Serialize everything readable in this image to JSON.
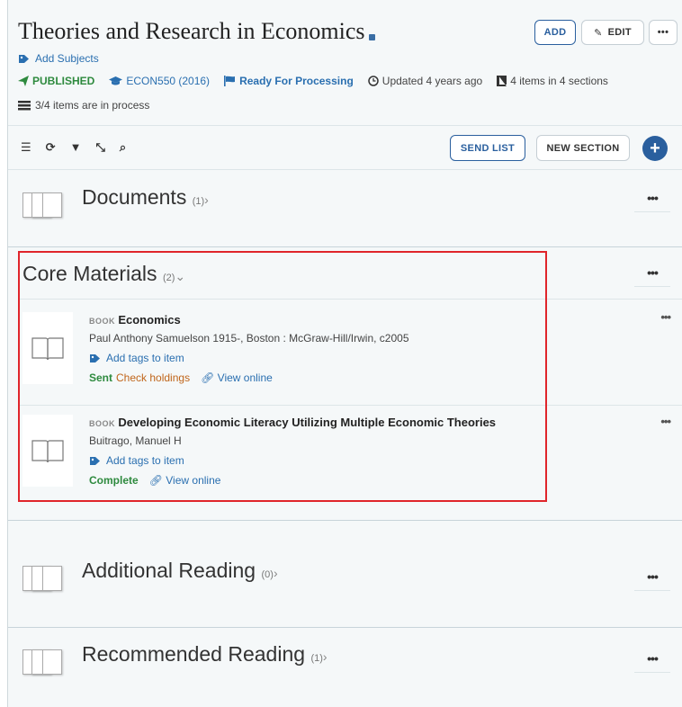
{
  "header": {
    "title": "Theories and Research in Economics",
    "add_label": "ADD",
    "edit_label": "EDIT",
    "more_label": "•••",
    "add_subjects": "Add Subjects",
    "status_published": "PUBLISHED",
    "course": "ECON550 (2016)",
    "processing": "Ready For Processing",
    "updated": "Updated 4 years ago",
    "items_count": "4 items in 4 sections",
    "in_process": "3/4 items are in process"
  },
  "toolbar": {
    "send_list": "SEND LIST",
    "new_section": "NEW SECTION",
    "plus": "+"
  },
  "sections": [
    {
      "title": "Documents",
      "count": "(1)",
      "more": "•••"
    },
    {
      "title": "Core Materials",
      "count": "(2)",
      "more": "•••"
    },
    {
      "title": "Additional Reading",
      "count": "(0)",
      "more": "•••"
    },
    {
      "title": "Recommended Reading",
      "count": "(1)",
      "more": "•••"
    }
  ],
  "items": [
    {
      "type": "BOOK",
      "title": "Economics",
      "author": "Paul Anthony Samuelson 1915-, Boston : McGraw-Hill/Irwin, c2005",
      "tags": "Add tags to item",
      "status": "Sent",
      "check": "Check holdings",
      "view": "View online",
      "more": "•••"
    },
    {
      "type": "BOOK",
      "title": "Developing Economic Literacy Utilizing Multiple Economic Theories",
      "author": "Buitrago, Manuel H",
      "tags": "Add tags to item",
      "status": "Complete",
      "view": "View online",
      "more": "•••"
    }
  ],
  "colors": {
    "accent": "#2a5f9e",
    "link": "#2a6fb0",
    "success": "#2e8a3e",
    "warning": "#c0651a",
    "highlight": "#e0252b"
  },
  "icons": [
    "tag-icon",
    "paper-plane-icon",
    "graduation-cap-icon",
    "flag-icon",
    "clock-icon",
    "book-icon",
    "list-icon",
    "refresh-icon",
    "filter-icon",
    "collapse-icon",
    "search-icon",
    "pencil-icon",
    "link-icon",
    "open-book-icon"
  ]
}
